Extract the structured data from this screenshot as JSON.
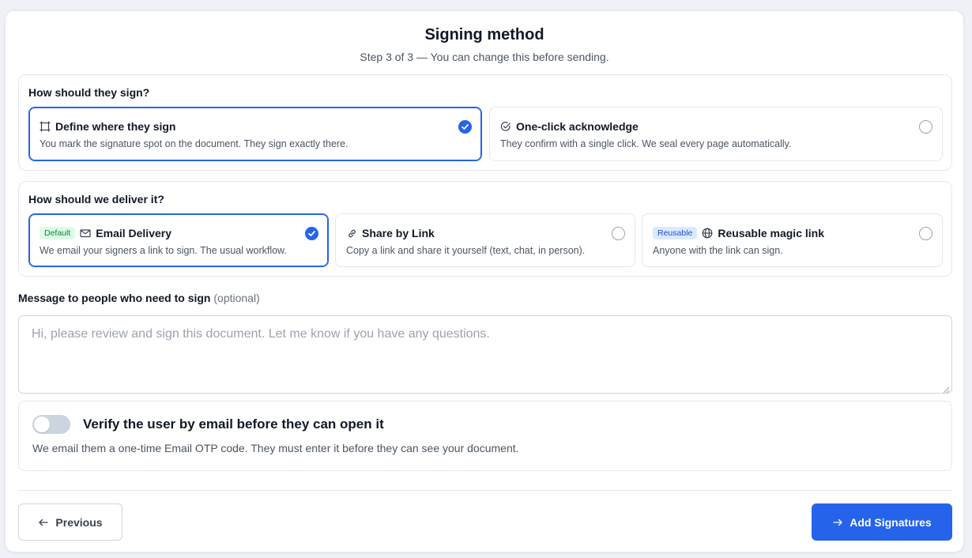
{
  "header": {
    "title": "Signing method",
    "subtitle": "Step 3 of 3 — You can change this before sending."
  },
  "sign_section": {
    "label": "How should they sign?",
    "options": [
      {
        "title": "Define where they sign",
        "description": "You mark the signature spot on the document. They sign exactly there.",
        "icon": "frame-icon",
        "selected": true
      },
      {
        "title": "One-click acknowledge",
        "description": "They confirm with a single click. We seal every page automatically.",
        "icon": "check-circle-icon",
        "selected": false
      }
    ]
  },
  "delivery_section": {
    "label": "How should we deliver it?",
    "options": [
      {
        "badge": "Default",
        "title": "Email Delivery",
        "description": "We email your signers a link to sign. The usual workflow.",
        "icon": "mail-icon",
        "selected": true
      },
      {
        "title": "Share by Link",
        "description": "Copy a link and share it yourself (text, chat, in person).",
        "icon": "link-icon",
        "selected": false
      },
      {
        "badge": "Reusable",
        "title": "Reusable magic link",
        "description": "Anyone with the link can sign.",
        "icon": "globe-icon",
        "selected": false
      }
    ]
  },
  "message": {
    "label": "Message to people who need to sign",
    "optional_label": "(optional)",
    "value": "",
    "placeholder": "Hi, please review and sign this document. Let me know if you have any questions."
  },
  "verify": {
    "title": "Verify the user by email before they can open it",
    "description": "We email them a one-time Email OTP code. They must enter it before they can see your document.",
    "enabled": false
  },
  "footer": {
    "previous_label": "Previous",
    "next_label": "Add Signatures"
  },
  "colors": {
    "accent": "#2563eb",
    "badge_default_bg": "#dcfce7",
    "badge_reusable_bg": "#dbeafe"
  }
}
